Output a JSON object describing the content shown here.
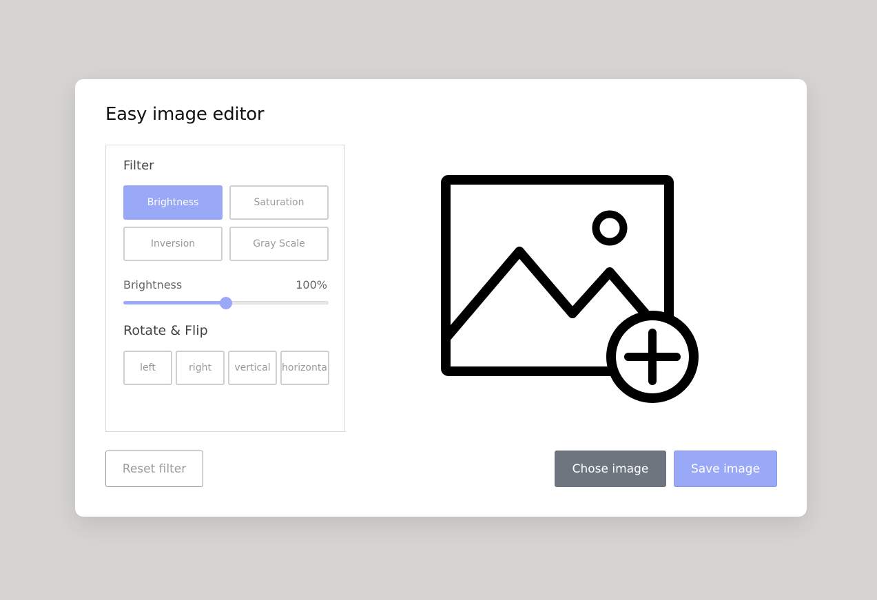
{
  "app": {
    "title": "Easy image editor"
  },
  "filter": {
    "heading": "Filter",
    "options": [
      {
        "label": "Brightness",
        "active": true
      },
      {
        "label": "Saturation",
        "active": false
      },
      {
        "label": "Inversion",
        "active": false
      },
      {
        "label": "Gray Scale",
        "active": false
      }
    ],
    "slider": {
      "label": "Brightness",
      "value_text": "100%",
      "value": 0.5
    }
  },
  "rotate": {
    "heading": "Rotate & Flip",
    "options": [
      {
        "label": "left"
      },
      {
        "label": "right"
      },
      {
        "label": "vertical"
      },
      {
        "label": "horizontal"
      }
    ]
  },
  "actions": {
    "reset_label": "Reset filter",
    "chose_label": "Chose image",
    "save_label": "Save image"
  },
  "preview": {
    "icon": "image-add-icon"
  },
  "colors": {
    "accent": "#9aa9f7",
    "dark_button": "#6d757f",
    "background": "#d5d4d2"
  }
}
